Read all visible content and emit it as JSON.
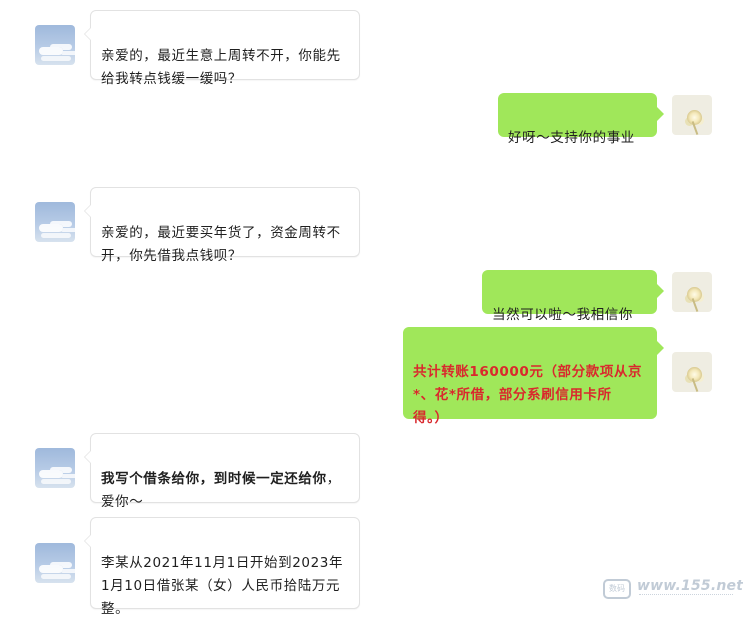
{
  "chat": {
    "messages": [
      {
        "side": "left",
        "avatar": "sky-avatar",
        "text": "亲爱的，最近生意上周转不开，你能先给我转点钱缓一缓吗？"
      },
      {
        "side": "right",
        "avatar": "flower-avatar",
        "text": "好呀～支持你的事业"
      },
      {
        "side": "left",
        "avatar": "sky-avatar",
        "text": "亲爱的，最近要买年货了，资金周转不开，你先借我点钱呗？"
      },
      {
        "side": "right",
        "avatar": "flower-avatar",
        "text": "当然可以啦～我相信你"
      },
      {
        "side": "right",
        "avatar": "flower-avatar",
        "text": "共计转账160000元（部分款项从京*、花*所借，部分系刷信用卡所得。）"
      },
      {
        "side": "left",
        "avatar": "sky-avatar",
        "text_bold": "我写个借条给你，到时候一定还给你",
        "text_rest": "，爱你～"
      },
      {
        "side": "left",
        "avatar": "sky-avatar",
        "text": "李某从2021年11月1日开始到2023年1月10日借张某（女）人民币拾陆万元整。"
      }
    ]
  },
  "watermark": {
    "logo_text": "数码",
    "site": "www.155.net"
  },
  "colors": {
    "sent_bubble": "#a0e75a",
    "received_bubble": "#ffffff",
    "highlight_text": "#d9292d"
  }
}
